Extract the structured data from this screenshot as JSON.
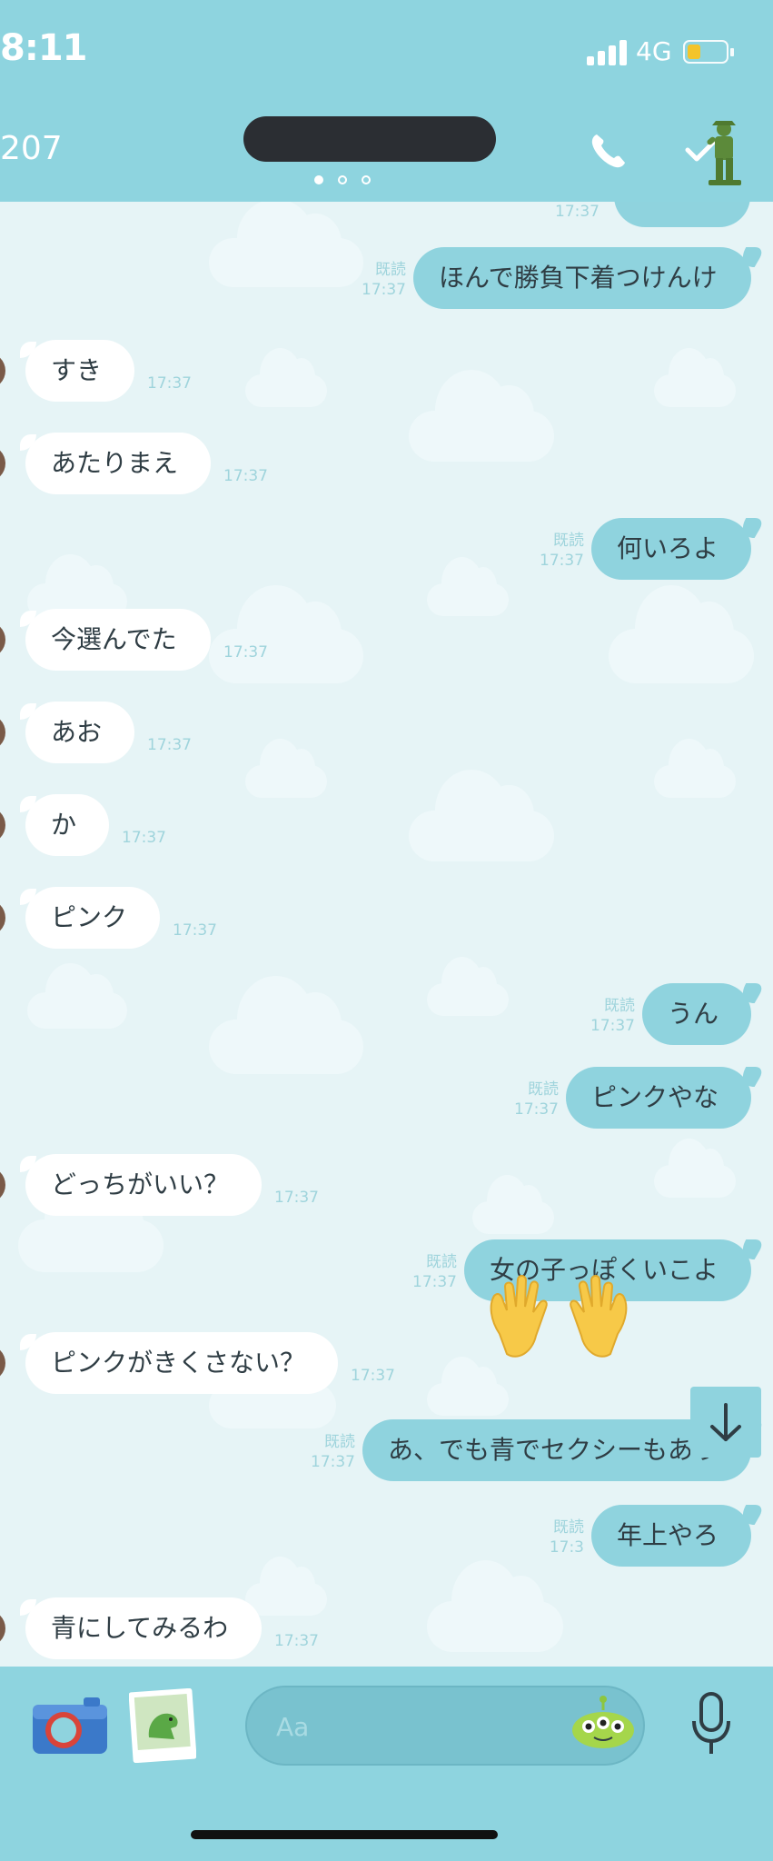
{
  "status_bar": {
    "time": "8:11",
    "network": "4G"
  },
  "header": {
    "count": "207",
    "page_dots": 3,
    "active_dot": 0
  },
  "messages": [
    {
      "dir": "out",
      "text": "ほんで勝負下着つけんけ",
      "read": "既読",
      "time": "17:37"
    },
    {
      "dir": "in",
      "text": "すき",
      "time": "17:37"
    },
    {
      "dir": "in",
      "text": "あたりまえ",
      "time": "17:37"
    },
    {
      "dir": "out",
      "text": "何いろよ",
      "read": "既読",
      "time": "17:37"
    },
    {
      "dir": "in",
      "text": "今選んでた",
      "time": "17:37"
    },
    {
      "dir": "in",
      "text": "あお",
      "time": "17:37"
    },
    {
      "dir": "in",
      "text": "か",
      "time": "17:37"
    },
    {
      "dir": "in",
      "text": "ピンク",
      "time": "17:37"
    },
    {
      "dir": "out",
      "text": "うん",
      "read": "既読",
      "time": "17:37"
    },
    {
      "dir": "out",
      "text": "ピンクやな",
      "read": "既読",
      "time": "17:37"
    },
    {
      "dir": "in",
      "text": "どっちがいい？",
      "time": "17:37"
    },
    {
      "dir": "out",
      "text": "女の子っぽくいこよ",
      "read": "既読",
      "time": "17:37"
    },
    {
      "dir": "in",
      "text": "ピンクがきくさない？",
      "time": "17:37"
    },
    {
      "dir": "out",
      "text": "あ、でも青でセクシーもあり",
      "read": "既読",
      "time": "17:37"
    },
    {
      "dir": "out",
      "text": "年上やろ",
      "read": "既読",
      "time": "17:3"
    },
    {
      "dir": "in",
      "text": "青にしてみるわ",
      "time": "17:37"
    }
  ],
  "top_partial_time": "17:37",
  "input": {
    "placeholder": "Aa",
    "value": ""
  },
  "colors": {
    "header": "#8ed4df",
    "out_bubble": "#8fd3de",
    "in_bubble": "#ffffff",
    "background": "#e6f4f6"
  }
}
